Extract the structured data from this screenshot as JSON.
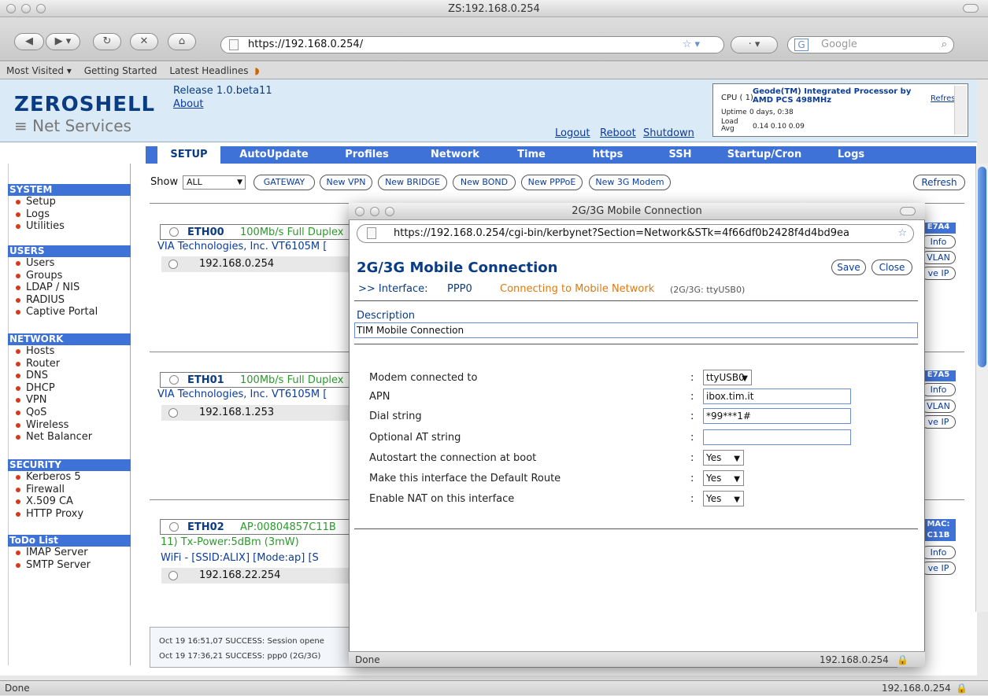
{
  "window": {
    "title": "ZS:192.168.0.254"
  },
  "browser": {
    "url": "https://192.168.0.254/",
    "search_placeholder": "Google",
    "bookmarks": [
      "Most Visited ▾",
      "Getting Started",
      "Latest Headlines"
    ],
    "status_left": "Done",
    "status_right": "192.168.0.254"
  },
  "header": {
    "logo_main": "ZEROSHELL",
    "logo_sub": "Net Services",
    "release": "Release 1.0.beta11",
    "about": "About",
    "links": [
      "Logout",
      "Reboot",
      "Shutdown"
    ],
    "cpu_label": "CPU ( 1)",
    "cpu_value": "Geode(TM) Integrated Processor by AMD PCS 498MHz",
    "uptime_label": "Uptime",
    "uptime_value": "0 days, 0:38",
    "load_label": "Load Avg",
    "load_value": "0.14 0.10 0.09",
    "refresh": "Refresh"
  },
  "menu": [
    "SETUP",
    "AutoUpdate",
    "Profiles",
    "Network",
    "Time",
    "https",
    "SSH",
    "Startup/Cron",
    "Logs"
  ],
  "sidebar": {
    "sections": [
      {
        "title": "SYSTEM",
        "items": [
          "Setup",
          "Logs",
          "Utilities"
        ]
      },
      {
        "title": "USERS",
        "items": [
          "Users",
          "Groups",
          "LDAP / NIS",
          "RADIUS",
          "Captive Portal"
        ]
      },
      {
        "title": "NETWORK",
        "items": [
          "Hosts",
          "Router",
          "DNS",
          "DHCP",
          "VPN",
          "QoS",
          "Wireless",
          "Net Balancer"
        ]
      },
      {
        "title": "SECURITY",
        "items": [
          "Kerberos 5",
          "Firewall",
          "X.509 CA",
          "HTTP Proxy"
        ]
      },
      {
        "title": "ToDo List",
        "items": [
          "IMAP Server",
          "SMTP Server"
        ]
      }
    ]
  },
  "toolbar": {
    "show_label": "Show",
    "show_value": "ALL",
    "buttons": [
      "GATEWAY",
      "New VPN",
      "New BRIDGE",
      "New BOND",
      "New PPPoE",
      "New 3G Modem"
    ],
    "refresh": "Refresh"
  },
  "interfaces": [
    {
      "name": "ETH00",
      "status": "100Mb/s Full Duplex",
      "vendor": "VIA Technologies, Inc. VT6105M [",
      "ip": "192.168.0.254",
      "mac_tag": "E7A4",
      "buttons": [
        "Info",
        "VLAN",
        "ve IP"
      ]
    },
    {
      "name": "ETH01",
      "status": "100Mb/s Full Duplex",
      "vendor": "VIA Technologies, Inc. VT6105M [",
      "ip": "192.168.1.253",
      "mac_tag": "E7A5",
      "buttons": [
        "Info",
        "VLAN",
        "ve IP"
      ]
    },
    {
      "name": "ETH02",
      "status": "AP:00804857C11B",
      "extra": "11) Tx-Power:5dBm (3mW)",
      "vendor": "WiFi - [SSID:ALIX] [Mode:ap] [S",
      "ip": "192.168.22.254",
      "mac_tag": "MAC: C11B",
      "buttons": [
        "Info",
        "ve IP"
      ]
    }
  ],
  "log": [
    "Oct 19 16:51,07 SUCCESS: Session opene",
    "Oct 19 17:36,21 SUCCESS: ppp0 (2G/3G)"
  ],
  "popup": {
    "window_title": "2G/3G Mobile Connection",
    "url": "https://192.168.0.254/cgi-bin/kerbynet?Section=Network&STk=4f66df0b2428f4d4bd9ea",
    "heading": "2G/3G Mobile Connection",
    "interface_prefix": ">> Interface:",
    "interface_name": "PPP0",
    "connecting": "Connecting to Mobile Network",
    "device_info": "(2G/3G: ttyUSB0)",
    "save": "Save",
    "close": "Close",
    "description_label": "Description",
    "description_value": "TIM Mobile Connection",
    "fields": [
      {
        "label": "Modem connected to",
        "value": "ttyUSB0",
        "kind": "select"
      },
      {
        "label": "APN",
        "value": "ibox.tim.it",
        "kind": "input"
      },
      {
        "label": "Dial string",
        "value": "*99***1#",
        "kind": "input"
      },
      {
        "label": "Optional AT string",
        "value": "",
        "kind": "input"
      },
      {
        "label": "Autostart the connection at boot",
        "value": "Yes",
        "kind": "select"
      },
      {
        "label": "Make this interface the Default Route",
        "value": "Yes",
        "kind": "select"
      },
      {
        "label": "Enable NAT on this interface",
        "value": "Yes",
        "kind": "select"
      }
    ],
    "status_left": "Done",
    "status_right": "192.168.0.254"
  }
}
